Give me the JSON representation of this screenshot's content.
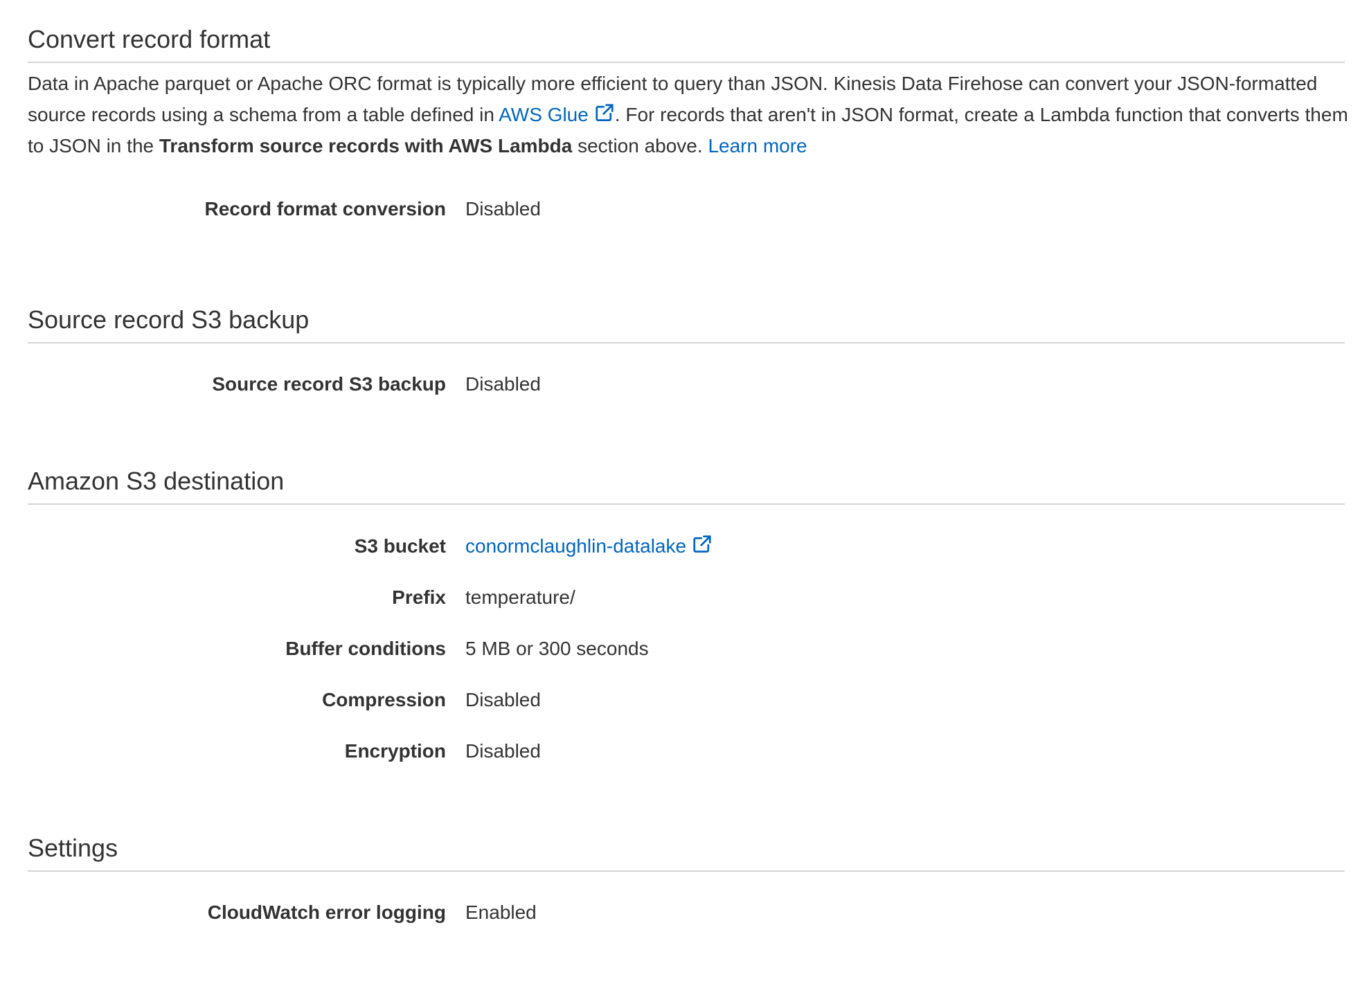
{
  "convert_record_format": {
    "title": "Convert record format",
    "description": {
      "part1": "Data in Apache parquet or Apache ORC format is typically more efficient to query than JSON. Kinesis Data Firehose can convert your JSON-formatted source records using a schema from a table defined in ",
      "glue_link": "AWS Glue",
      "part2": ". For records that aren't in JSON format, create a Lambda function that converts them to JSON in the ",
      "bold_text": "Transform source records with AWS Lambda",
      "part3": " section above. ",
      "learn_more": "Learn more"
    },
    "fields": [
      {
        "label": "Record format conversion",
        "value": "Disabled"
      }
    ]
  },
  "source_record_backup": {
    "title": "Source record S3 backup",
    "fields": [
      {
        "label": "Source record S3 backup",
        "value": "Disabled"
      }
    ]
  },
  "s3_destination": {
    "title": "Amazon S3 destination",
    "bucket": {
      "label": "S3 bucket",
      "value": "conormclaughlin-datalake"
    },
    "fields": [
      {
        "label": "Prefix",
        "value": "temperature/"
      },
      {
        "label": "Buffer conditions",
        "value": "5 MB or 300 seconds"
      },
      {
        "label": "Compression",
        "value": "Disabled"
      },
      {
        "label": "Encryption",
        "value": "Disabled"
      }
    ]
  },
  "settings": {
    "title": "Settings",
    "fields": [
      {
        "label": "CloudWatch error logging",
        "value": "Enabled"
      }
    ]
  },
  "icons": {
    "external_link": "external-link-icon"
  },
  "colors": {
    "link": "#0066c0",
    "text": "#333333",
    "divider": "#d5d5d5"
  }
}
